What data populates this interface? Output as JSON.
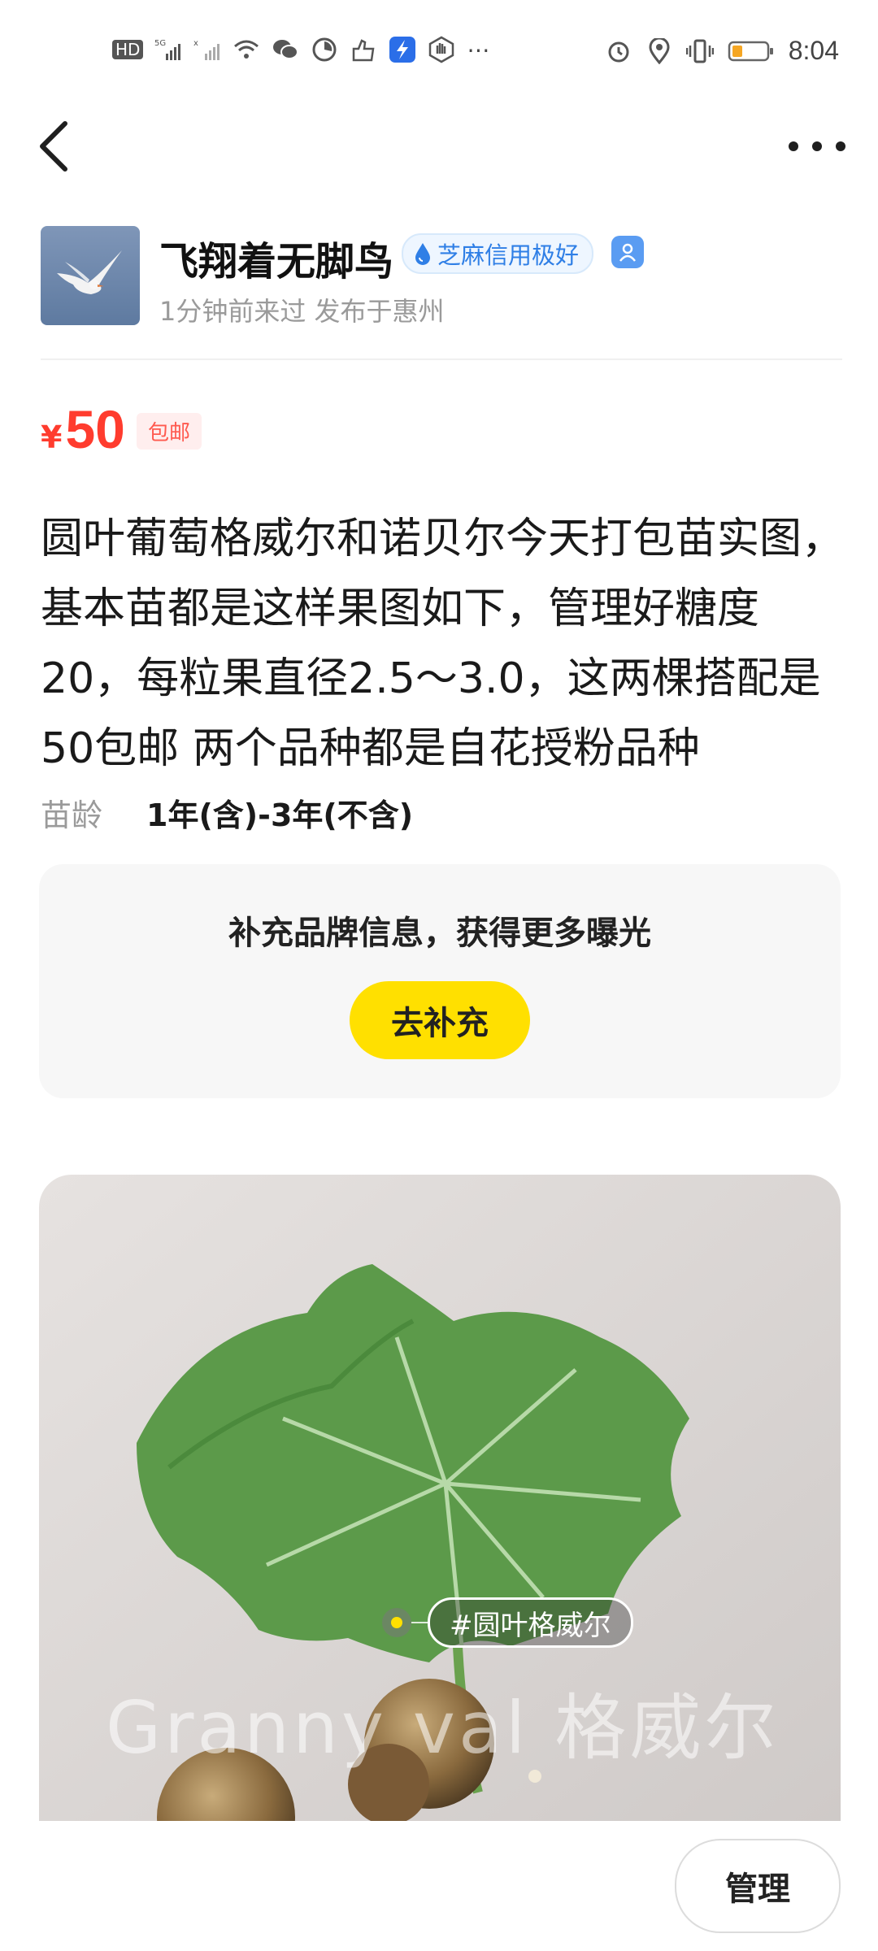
{
  "status_bar": {
    "hd_label": "HD",
    "network": "5G",
    "time": "8:04",
    "icons": [
      "hd-icon",
      "signal-icon",
      "signal-x-icon",
      "wifi-icon",
      "wechat-icon",
      "clock-app-icon",
      "hand-app-icon",
      "app-icon",
      "palm-icon",
      "more-dots-icon",
      "alarm-icon",
      "location-icon",
      "vibrate-icon",
      "battery-icon"
    ]
  },
  "nav": {
    "back_icon": "chevron-left-icon",
    "more_icon": "more-dots-icon"
  },
  "seller": {
    "name": "飞翔着无脚鸟",
    "credit_badge": "芝麻信用极好",
    "meta": "1分钟前来过 发布于惠州"
  },
  "price": {
    "currency": "¥",
    "amount": "50",
    "shipping": "包邮"
  },
  "description": "圆叶葡萄格威尔和诺贝尔今天打包苗实图，基本苗都是这样果图如下，管理好糖度20，每粒果直径2.5～3.0，这两棵搭配是50包邮 两个品种都是自花授粉品种",
  "attribute": {
    "label": "苗龄",
    "value": "1年(含)-3年(不含)"
  },
  "brand_card": {
    "text": "补充品牌信息，获得更多曝光",
    "button": "去补充"
  },
  "photo": {
    "tag": "#圆叶格威尔",
    "watermark": "Granny val 格威尔"
  },
  "bottom": {
    "manage": "管理"
  },
  "colors": {
    "price": "#ff3c2e",
    "accent_yellow": "#ffe000",
    "credit_blue": "#2f7fe6"
  }
}
